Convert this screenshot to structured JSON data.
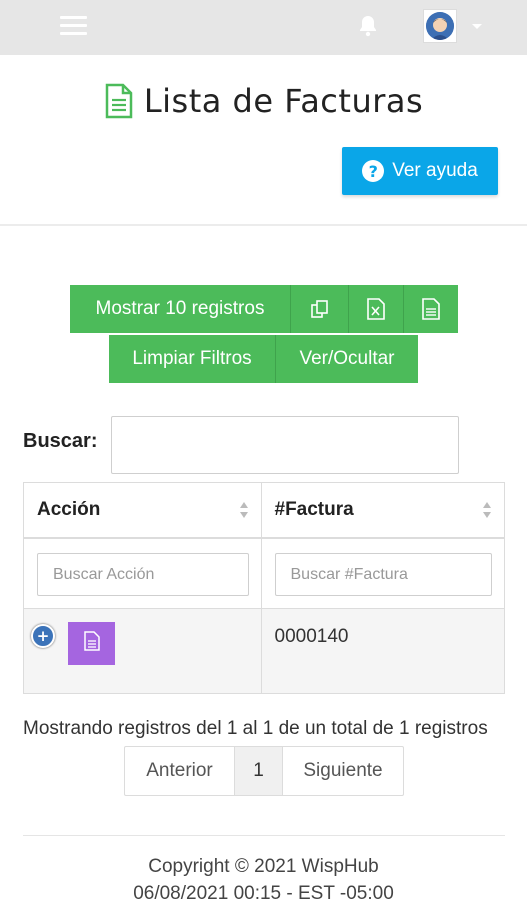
{
  "topbar": {
    "menu_icon": "hamburger-icon",
    "notification_icon": "bell-icon",
    "avatar_icon": "user-avatar"
  },
  "header": {
    "title": "Lista de Facturas",
    "title_icon": "document-icon",
    "help_label": "Ver ayuda",
    "help_icon": "question-circle-icon"
  },
  "toolbar": {
    "show_records_label": "Mostrar 10 registros",
    "copy_icon": "copy-icon",
    "excel_icon": "excel-icon",
    "pdf_icon": "file-icon",
    "clear_filters_label": "Limpiar Filtros",
    "toggle_columns_label": "Ver/Ocultar"
  },
  "search": {
    "label": "Buscar:",
    "value": ""
  },
  "table": {
    "columns": [
      {
        "label": "Acción",
        "filter_placeholder": "Buscar Acción"
      },
      {
        "label": "#Factura",
        "filter_placeholder": "Buscar #Factura"
      }
    ],
    "rows": [
      {
        "invoice_number": "0000140"
      }
    ]
  },
  "info": "Mostrando registros del 1 al 1 de un total de 1 registros",
  "pagination": {
    "prev_label": "Anterior",
    "current_page": "1",
    "next_label": "Siguiente"
  },
  "footer": {
    "copyright": "Copyright © 2021 WispHub",
    "datetime": "06/08/2021 00:15 - EST -05:00"
  },
  "colors": {
    "topbar": "#e6e6e6",
    "green": "#4cbb5a",
    "blue": "#0aa6e8",
    "purple": "#a565e0"
  }
}
